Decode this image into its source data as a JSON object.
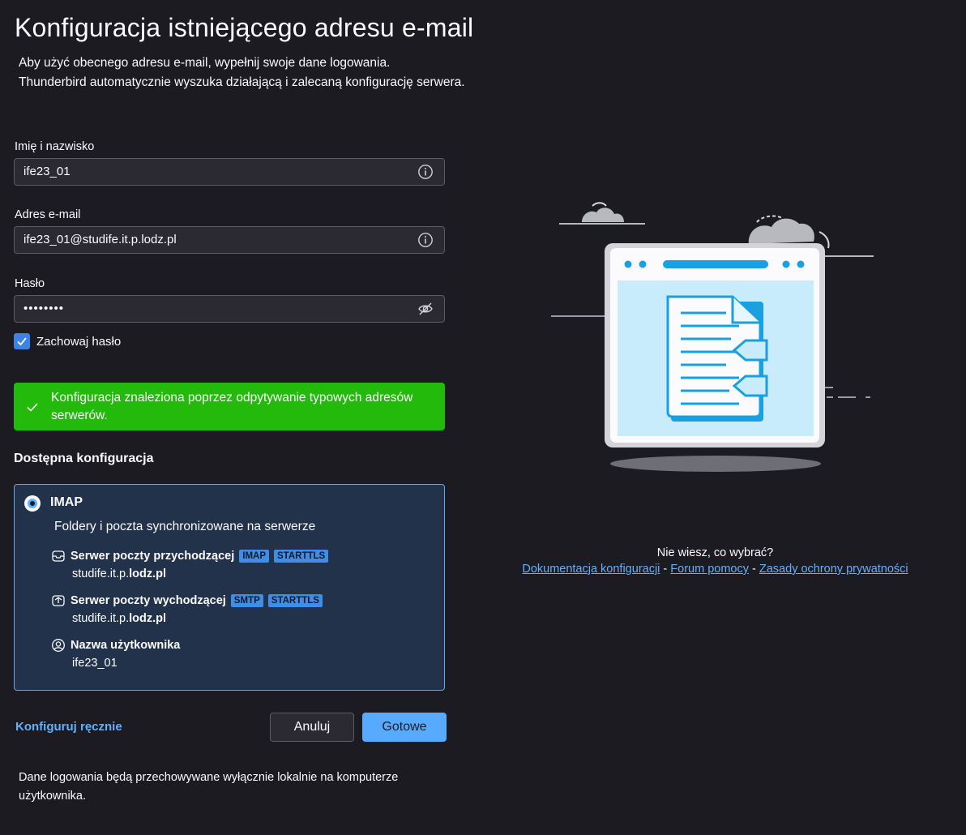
{
  "title": "Konfiguracja istniejącego adresu e-mail",
  "description": {
    "line1": "Aby użyć obecnego adresu e-mail, wypełnij swoje dane logowania.",
    "line2": "Thunderbird automatycznie wyszuka działającą i zalecaną konfigurację serwera."
  },
  "form": {
    "name_label": "Imię i nazwisko",
    "name_value": "ife23_01",
    "email_label": "Adres e-mail",
    "email_value": "ife23_01@studife.it.p.lodz.pl",
    "password_label": "Hasło",
    "password_value": "••••••••",
    "remember_label": "Zachowaj hasło",
    "remember_checked": true
  },
  "success_message": "Konfiguracja znaleziona poprzez odpytywanie typowych adresów serwerów.",
  "available_config": {
    "heading": "Dostępna konfiguracja",
    "protocol": "IMAP",
    "protocol_desc": "Foldery i poczta synchronizowane na serwerze",
    "incoming": {
      "label": "Serwer poczty przychodzącej",
      "badges": [
        "IMAP",
        "STARTTLS"
      ],
      "host_prefix": "studife.it.p.",
      "host_bold": "lodz.pl"
    },
    "outgoing": {
      "label": "Serwer poczty wychodzącej",
      "badges": [
        "SMTP",
        "STARTTLS"
      ],
      "host_prefix": "studife.it.p.",
      "host_bold": "lodz.pl"
    },
    "username": {
      "label": "Nazwa użytkownika",
      "value": "ife23_01"
    }
  },
  "actions": {
    "manual": "Konfiguruj ręcznie",
    "cancel": "Anuluj",
    "done": "Gotowe"
  },
  "footer_note": "Dane logowania będą przechowywane wyłącznie lokalnie na komputerze użytkownika.",
  "help": {
    "question": "Nie wiesz, co wybrać?",
    "link_docs": "Dokumentacja konfiguracji",
    "link_forum": "Forum pomocy",
    "link_privacy": "Zasady ochrony prywatności",
    "separator": " - "
  },
  "colors": {
    "background": "#1c1b22",
    "success": "#23ba0b",
    "accent": "#58aaff",
    "card_bg": "#22324a",
    "link": "#62b1ff"
  }
}
